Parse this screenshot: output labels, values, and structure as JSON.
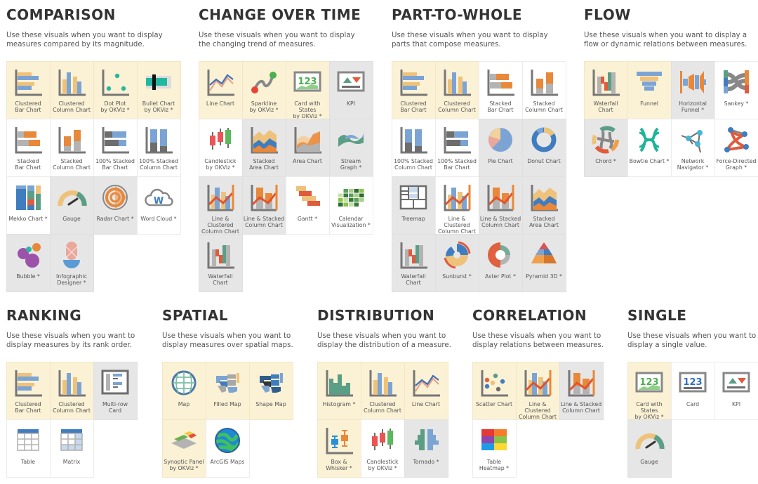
{
  "colors": {
    "tile_highlight": "#fbf1d5",
    "tile_gray": "#e6e6e6",
    "tile_white": "#ffffff",
    "blue": "#7ba4d4",
    "orange": "#e8883a",
    "tan": "#eec27a",
    "teal": "#5a9e85",
    "gray": "#777777"
  },
  "sections": {
    "comparison": {
      "title": "COMPARISON",
      "description": "Use these visuals when you want to display\nmeasures compared by its magnitude.",
      "tiles": [
        {
          "label": "Clustered\nBar Chart",
          "icon": "clustered-bar-chart-icon",
          "state": "highlighted"
        },
        {
          "label": "Clustered\nColumn Chart",
          "icon": "clustered-column-chart-icon",
          "state": "highlighted"
        },
        {
          "label": "Dot Plot\nby OKViz *",
          "icon": "dot-plot-icon",
          "state": "highlighted"
        },
        {
          "label": "Bullet Chart\nby OKViz *",
          "icon": "bullet-chart-icon",
          "state": "highlighted"
        },
        {
          "label": "Stacked\nBar Chart",
          "icon": "stacked-bar-chart-icon",
          "state": "white"
        },
        {
          "label": "Stacked\nColumn Chart",
          "icon": "stacked-column-chart-icon",
          "state": "white"
        },
        {
          "label": "100% Stacked\nBar Chart",
          "icon": "100-stacked-bar-chart-icon",
          "state": "white"
        },
        {
          "label": "100% Stacked\nColumn Chart",
          "icon": "100-stacked-column-chart-icon",
          "state": "white"
        },
        {
          "label": "Mekko Chart *",
          "icon": "mekko-chart-icon",
          "state": "white"
        },
        {
          "label": "Gauge",
          "icon": "gauge-icon",
          "state": "gray"
        },
        {
          "label": "Radar Chart *",
          "icon": "radar-chart-icon",
          "state": "gray"
        },
        {
          "label": "Word Cloud *",
          "icon": "word-cloud-icon",
          "state": "white"
        },
        {
          "label": "Bubble *",
          "icon": "bubble-chart-icon",
          "state": "gray"
        },
        {
          "label": "Infographic\nDesigner *",
          "icon": "infographic-designer-icon",
          "state": "gray"
        }
      ]
    },
    "change_over_time": {
      "title": "CHANGE OVER TIME",
      "description": "Use these visuals when you want to display\nthe changing trend of measures.",
      "tiles": [
        {
          "label": "Line Chart",
          "icon": "line-chart-icon",
          "state": "highlighted"
        },
        {
          "label": "Sparkline\nby OKViz *",
          "icon": "sparkline-icon",
          "state": "highlighted"
        },
        {
          "label": "Card with States\nby OKViz *",
          "icon": "card-with-states-icon",
          "state": "highlighted"
        },
        {
          "label": "KPI",
          "icon": "kpi-icon",
          "state": "gray"
        },
        {
          "label": "Candlestick\nby OKViz *",
          "icon": "candlestick-icon",
          "state": "white"
        },
        {
          "label": "Stacked\nArea Chart",
          "icon": "stacked-area-chart-icon",
          "state": "gray"
        },
        {
          "label": "Area Chart",
          "icon": "area-chart-icon",
          "state": "gray"
        },
        {
          "label": "Stream\nGraph *",
          "icon": "stream-graph-icon",
          "state": "gray"
        },
        {
          "label": "Line & Clustered\nColumn Chart",
          "icon": "line-clustered-column-chart-icon",
          "state": "gray"
        },
        {
          "label": "Line & Stacked\nColumn Chart",
          "icon": "line-stacked-column-chart-icon",
          "state": "gray"
        },
        {
          "label": "Gantt *",
          "icon": "gantt-icon",
          "state": "white"
        },
        {
          "label": "Calendar\nVisualization *",
          "icon": "calendar-visualization-icon",
          "state": "white"
        },
        {
          "label": "Waterfall\nChart",
          "icon": "waterfall-chart-icon",
          "state": "gray"
        }
      ]
    },
    "part_to_whole": {
      "title": "PART-TO-WHOLE",
      "description": "Use these visuals when you want to display\nparts that compose measures.",
      "tiles": [
        {
          "label": "Clustered\nBar Chart",
          "icon": "clustered-bar-chart-icon",
          "state": "highlighted"
        },
        {
          "label": "Clustered\nColumn Chart",
          "icon": "clustered-column-chart-icon",
          "state": "highlighted"
        },
        {
          "label": "Stacked\nBar Chart",
          "icon": "stacked-bar-chart-icon",
          "state": "white"
        },
        {
          "label": "Stacked\nColumn Chart",
          "icon": "stacked-column-chart-icon",
          "state": "white"
        },
        {
          "label": "100% Stacked\nColumn Chart",
          "icon": "100-stacked-column-chart-icon",
          "state": "white"
        },
        {
          "label": "100% Stacked\nBar Chart",
          "icon": "100-stacked-bar-chart-icon",
          "state": "white"
        },
        {
          "label": "Pie Chart",
          "icon": "pie-chart-icon",
          "state": "gray"
        },
        {
          "label": "Donut Chart",
          "icon": "donut-chart-icon",
          "state": "gray"
        },
        {
          "label": "Treemap",
          "icon": "treemap-icon",
          "state": "gray"
        },
        {
          "label": "Line & Clustered\nColumn Chart",
          "icon": "line-clustered-column-chart-icon",
          "state": "white"
        },
        {
          "label": "Line & Stacked\nColumn Chart",
          "icon": "line-stacked-column-chart-icon",
          "state": "gray"
        },
        {
          "label": "Stacked\nArea Chart",
          "icon": "stacked-area-chart-icon",
          "state": "gray"
        },
        {
          "label": "Waterfall\nChart",
          "icon": "waterfall-chart-icon",
          "state": "gray"
        },
        {
          "label": "Sunburst *",
          "icon": "sunburst-icon",
          "state": "gray"
        },
        {
          "label": "Aster Plot *",
          "icon": "aster-plot-icon",
          "state": "gray"
        },
        {
          "label": "Pyramid 3D *",
          "icon": "pyramid-3d-icon",
          "state": "gray"
        }
      ]
    },
    "flow": {
      "title": "FLOW",
      "description": "Use these visuals when you want to display a\nflow or dynamic relations between measures.",
      "tiles": [
        {
          "label": "Waterfall\nChart",
          "icon": "waterfall-chart-icon",
          "state": "highlighted"
        },
        {
          "label": "Funnel",
          "icon": "funnel-icon",
          "state": "highlighted"
        },
        {
          "label": "Horizontal\nFunnel *",
          "icon": "horizontal-funnel-icon",
          "state": "gray"
        },
        {
          "label": "Sankey *",
          "icon": "sankey-icon",
          "state": "white"
        },
        {
          "label": "Chord *",
          "icon": "chord-icon",
          "state": "gray"
        },
        {
          "label": "Bowtie Chart *",
          "icon": "bowtie-chart-icon",
          "state": "white"
        },
        {
          "label": "Network\nNavigator *",
          "icon": "network-navigator-icon",
          "state": "white"
        },
        {
          "label": "Force-Directed\nGraph *",
          "icon": "force-directed-graph-icon",
          "state": "white"
        }
      ]
    },
    "ranking": {
      "title": "RANKING",
      "description": "Use these visuals when you want to\ndisplay measures by its rank order.",
      "tiles": [
        {
          "label": "Clustered\nBar Chart",
          "icon": "clustered-bar-chart-icon",
          "state": "highlighted"
        },
        {
          "label": "Clustered\nColumn Chart",
          "icon": "clustered-column-chart-icon",
          "state": "highlighted"
        },
        {
          "label": "Multi-row\nCard",
          "icon": "multi-row-card-icon",
          "state": "gray"
        },
        {
          "label": "Table",
          "icon": "table-icon",
          "state": "white"
        },
        {
          "label": "Matrix",
          "icon": "matrix-icon",
          "state": "white"
        }
      ]
    },
    "spatial": {
      "title": "SPATIAL",
      "description": "Use these visuals when you want to\ndisplay measures over spatial maps.",
      "tiles": [
        {
          "label": "Map",
          "icon": "map-globe-icon",
          "state": "highlighted"
        },
        {
          "label": "Filled Map",
          "icon": "filled-map-icon",
          "state": "highlighted"
        },
        {
          "label": "Shape Map",
          "icon": "shape-map-icon",
          "state": "highlighted"
        },
        {
          "label": "Synoptic Panel\nby OKViz *",
          "icon": "synoptic-panel-icon",
          "state": "highlighted"
        },
        {
          "label": "ArcGIS Maps",
          "icon": "arcgis-maps-icon",
          "state": "white"
        }
      ]
    },
    "distribution": {
      "title": "DISTRIBUTION",
      "description": "Use these visuals when you want to\ndisplay the distribution of a measure.",
      "tiles": [
        {
          "label": "Histogram *",
          "icon": "histogram-icon",
          "state": "highlighted"
        },
        {
          "label": "Clustered\nColumn Chart",
          "icon": "clustered-column-chart-icon",
          "state": "highlighted"
        },
        {
          "label": "Line Chart",
          "icon": "line-chart-icon",
          "state": "highlighted"
        },
        {
          "label": "Box &\nWhisker *",
          "icon": "box-whisker-icon",
          "state": "highlighted"
        },
        {
          "label": "Candlestick\nby OKViz *",
          "icon": "candlestick-icon",
          "state": "white"
        },
        {
          "label": "Tornado *",
          "icon": "tornado-icon",
          "state": "gray"
        }
      ]
    },
    "correlation": {
      "title": "CORRELATION",
      "description": "Use these visuals when you want to\ndisplay relations between measures.",
      "tiles": [
        {
          "label": "Scatter Chart",
          "icon": "scatter-chart-icon",
          "state": "highlighted"
        },
        {
          "label": "Line & Clustered\nColumn Chart",
          "icon": "line-clustered-column-chart-icon",
          "state": "highlighted"
        },
        {
          "label": "Line & Stacked\nColumn Chart",
          "icon": "line-stacked-column-chart-icon",
          "state": "gray"
        },
        {
          "label": "Table\nHeatmap *",
          "icon": "table-heatmap-icon",
          "state": "white"
        }
      ]
    },
    "single": {
      "title": "SINGLE",
      "description": "Use these visuals when you want to\ndisplay a single value.",
      "tiles": [
        {
          "label": "Card with States\nby OKViz *",
          "icon": "card-with-states-icon",
          "state": "highlighted"
        },
        {
          "label": "Card",
          "icon": "card-icon",
          "state": "white"
        },
        {
          "label": "KPI",
          "icon": "kpi-icon",
          "state": "white"
        },
        {
          "label": "Gauge",
          "icon": "gauge-icon",
          "state": "gray"
        }
      ]
    }
  }
}
